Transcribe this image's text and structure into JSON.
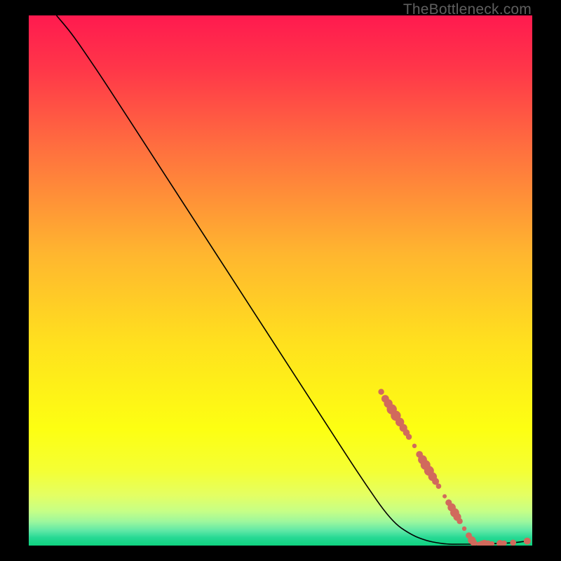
{
  "watermark": "TheBottleneck.com",
  "chart_data": {
    "type": "line",
    "title": "",
    "xlabel": "",
    "ylabel": "",
    "xlim": [
      0,
      100
    ],
    "ylim": [
      0,
      100
    ],
    "grid": false,
    "legend": false,
    "background_gradient": {
      "direction": "vertical",
      "stops": [
        {
          "pos": 0.0,
          "color": "#ff1a4f"
        },
        {
          "pos": 0.1,
          "color": "#ff3649"
        },
        {
          "pos": 0.25,
          "color": "#ff6f3f"
        },
        {
          "pos": 0.45,
          "color": "#ffb62f"
        },
        {
          "pos": 0.62,
          "color": "#ffe11e"
        },
        {
          "pos": 0.78,
          "color": "#fdff12"
        },
        {
          "pos": 0.86,
          "color": "#f4ff35"
        },
        {
          "pos": 0.905,
          "color": "#e4ff63"
        },
        {
          "pos": 0.935,
          "color": "#c6ff86"
        },
        {
          "pos": 0.955,
          "color": "#9cf79d"
        },
        {
          "pos": 0.972,
          "color": "#5fe8a6"
        },
        {
          "pos": 0.985,
          "color": "#27d994"
        },
        {
          "pos": 1.0,
          "color": "#0ed27f"
        }
      ]
    },
    "series": [
      {
        "name": "curve",
        "color": "#000000",
        "width": 1.6,
        "x": [
          5.5,
          8.0,
          10.0,
          12.0,
          14.0,
          18.0,
          24.0,
          30.0,
          36.0,
          42.0,
          48.0,
          54.0,
          60.0,
          66.0,
          72.0,
          76.0,
          79.0,
          81.5,
          83.0,
          84.0,
          85.0,
          90.0,
          96.0,
          99.0
        ],
        "y": [
          100.0,
          97.2,
          94.6,
          91.8,
          89.0,
          83.2,
          74.4,
          65.6,
          56.8,
          48.0,
          39.2,
          30.4,
          21.6,
          12.8,
          4.6,
          2.0,
          0.9,
          0.45,
          0.3,
          0.25,
          0.25,
          0.28,
          0.5,
          0.85
        ]
      }
    ],
    "markers": {
      "name": "dots",
      "color": "#d16a5c",
      "radius_range": [
        3,
        7.5
      ],
      "points": [
        {
          "x": 70.0,
          "y": 29.0,
          "r": 4.2
        },
        {
          "x": 70.8,
          "y": 27.7,
          "r": 5.4
        },
        {
          "x": 71.4,
          "y": 26.8,
          "r": 6.2
        },
        {
          "x": 72.1,
          "y": 25.7,
          "r": 7.2
        },
        {
          "x": 72.9,
          "y": 24.5,
          "r": 7.2
        },
        {
          "x": 73.7,
          "y": 23.3,
          "r": 6.2
        },
        {
          "x": 74.4,
          "y": 22.2,
          "r": 5.6
        },
        {
          "x": 75.0,
          "y": 21.3,
          "r": 4.8
        },
        {
          "x": 75.5,
          "y": 20.5,
          "r": 4.2
        },
        {
          "x": 76.6,
          "y": 18.8,
          "r": 3.2
        },
        {
          "x": 77.6,
          "y": 17.2,
          "r": 4.9
        },
        {
          "x": 78.2,
          "y": 16.2,
          "r": 6.4
        },
        {
          "x": 78.8,
          "y": 15.2,
          "r": 7.0
        },
        {
          "x": 79.5,
          "y": 14.1,
          "r": 7.0
        },
        {
          "x": 80.2,
          "y": 13.0,
          "r": 6.2
        },
        {
          "x": 80.8,
          "y": 12.1,
          "r": 5.0
        },
        {
          "x": 81.4,
          "y": 11.2,
          "r": 3.8
        },
        {
          "x": 82.6,
          "y": 9.3,
          "r": 3.0
        },
        {
          "x": 83.4,
          "y": 8.1,
          "r": 4.6
        },
        {
          "x": 84.0,
          "y": 7.2,
          "r": 5.8
        },
        {
          "x": 84.6,
          "y": 6.2,
          "r": 6.4
        },
        {
          "x": 85.1,
          "y": 5.4,
          "r": 5.6
        },
        {
          "x": 85.6,
          "y": 4.6,
          "r": 4.2
        },
        {
          "x": 86.5,
          "y": 3.2,
          "r": 3.2
        },
        {
          "x": 87.4,
          "y": 1.9,
          "r": 4.4
        },
        {
          "x": 88.0,
          "y": 1.0,
          "r": 5.6
        },
        {
          "x": 88.4,
          "y": 0.5,
          "r": 4.8
        },
        {
          "x": 89.4,
          "y": 0.28,
          "r": 3.4
        },
        {
          "x": 90.0,
          "y": 0.29,
          "r": 4.8
        },
        {
          "x": 90.5,
          "y": 0.3,
          "r": 5.8
        },
        {
          "x": 91.2,
          "y": 0.31,
          "r": 5.0
        },
        {
          "x": 92.0,
          "y": 0.33,
          "r": 3.6
        },
        {
          "x": 93.6,
          "y": 0.4,
          "r": 5.0
        },
        {
          "x": 94.4,
          "y": 0.45,
          "r": 4.0
        },
        {
          "x": 96.2,
          "y": 0.55,
          "r": 4.4
        },
        {
          "x": 99.0,
          "y": 0.85,
          "r": 5.0
        }
      ]
    }
  }
}
